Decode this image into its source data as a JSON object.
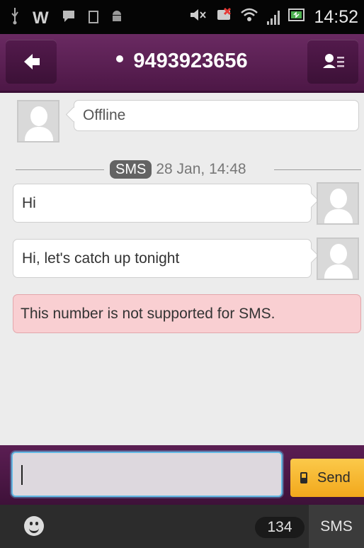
{
  "status_bar": {
    "time": "14:52",
    "icons": [
      "usb-icon",
      "w-app-icon",
      "chat-notification-icon",
      "notification-square-icon",
      "android-icon",
      "mute-icon",
      "missed-call-icon",
      "wifi-icon",
      "signal-icon",
      "battery-icon"
    ]
  },
  "header": {
    "title": "9493923656",
    "back_icon": "back-arrow-icon",
    "contacts_icon": "contact-list-icon",
    "accent": "#5a1f52"
  },
  "chat": {
    "presence": "Offline",
    "divider": {
      "tag": "SMS",
      "date": "28 Jan, 14:48"
    },
    "messages": [
      {
        "text": "Hi"
      },
      {
        "text": "Hi, let's catch up tonight"
      }
    ],
    "error": "This number is not supported for SMS.",
    "error_color": "#f9cfd2"
  },
  "compose": {
    "input_value": "",
    "send_label": "Send",
    "send_color": "#f6b72e"
  },
  "bottom_bar": {
    "emoji_icon": "smiley-icon",
    "char_count": "134",
    "mode": "SMS"
  }
}
